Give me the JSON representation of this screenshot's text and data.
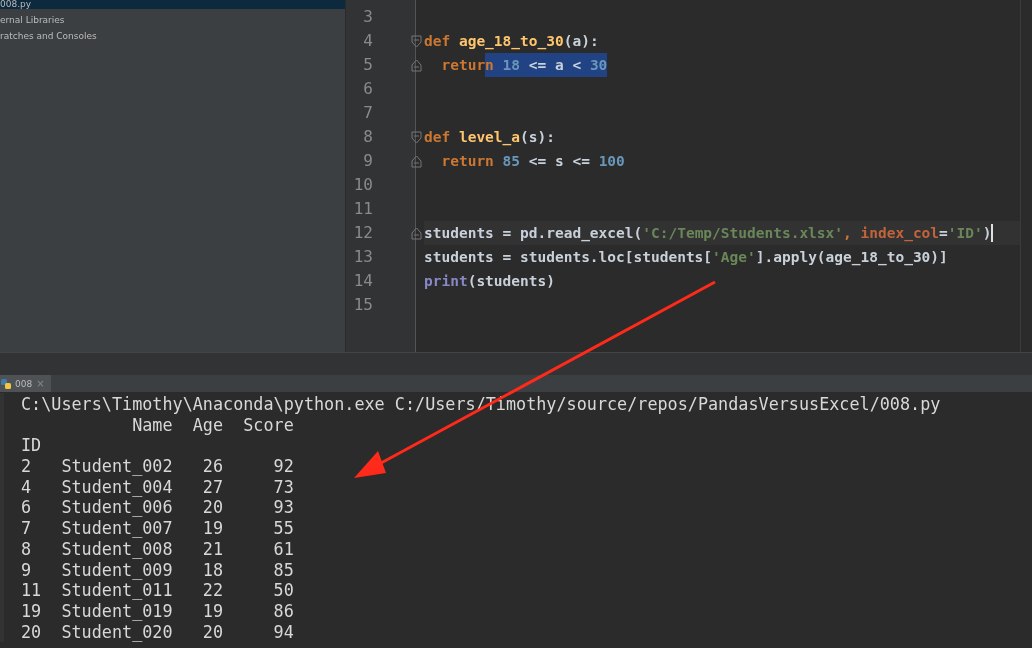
{
  "sidebar": {
    "items": [
      {
        "label": "008.py",
        "selected": true
      },
      {
        "label": "ernal Libraries",
        "selected": false
      },
      {
        "label": "ratches and Consoles",
        "selected": false
      }
    ]
  },
  "editor": {
    "lines": [
      {
        "number": "3",
        "kind": "plain",
        "current": false
      },
      {
        "number": "4",
        "kind": "fold_start",
        "current": false,
        "tokens": [
          {
            "text": "def ",
            "kind": "keyword"
          },
          {
            "text": "age_18_to_30",
            "kind": "function"
          },
          {
            "text": "(a):",
            "kind": "plain"
          }
        ]
      },
      {
        "number": "5",
        "kind": "fold_end",
        "current": false,
        "tokens": [
          {
            "text": "  retur",
            "kind": "keyword",
            "selected": false
          },
          {
            "text": "n",
            "kind": "keyword",
            "selected": true
          },
          {
            "text": " 18",
            "kind": "number",
            "selected": true
          },
          {
            "text": " <= a < ",
            "kind": "plain",
            "selected": true
          },
          {
            "text": "30",
            "kind": "number",
            "selected": true
          }
        ]
      },
      {
        "number": "6",
        "kind": "plain",
        "current": false
      },
      {
        "number": "7",
        "kind": "plain",
        "current": false
      },
      {
        "number": "8",
        "kind": "fold_start",
        "current": false,
        "tokens": [
          {
            "text": "def ",
            "kind": "keyword"
          },
          {
            "text": "level_a",
            "kind": "function"
          },
          {
            "text": "(s):",
            "kind": "plain"
          }
        ]
      },
      {
        "number": "9",
        "kind": "fold_end",
        "current": false,
        "tokens": [
          {
            "text": "  return ",
            "kind": "keyword"
          },
          {
            "text": "85",
            "kind": "number"
          },
          {
            "text": " <= s <= ",
            "kind": "plain"
          },
          {
            "text": "100",
            "kind": "number"
          }
        ]
      },
      {
        "number": "10",
        "kind": "plain",
        "current": false
      },
      {
        "number": "11",
        "kind": "plain",
        "current": false
      },
      {
        "number": "12",
        "kind": "fold_end",
        "current": true,
        "tokens": [
          {
            "text": "students = pd.read_excel(",
            "kind": "plain"
          },
          {
            "text": "'C:/Temp/Students.xlsx'",
            "kind": "string"
          },
          {
            "text": ", ",
            "kind": "keyword"
          },
          {
            "text": "index_col",
            "kind": "param"
          },
          {
            "text": "=",
            "kind": "plain"
          },
          {
            "text": "'ID'",
            "kind": "string"
          },
          {
            "text": ")",
            "kind": "plain"
          }
        ]
      },
      {
        "number": "13",
        "kind": "plain",
        "current": false,
        "tokens": [
          {
            "text": "students = students.loc[students[",
            "kind": "plain"
          },
          {
            "text": "'Age'",
            "kind": "string"
          },
          {
            "text": "].apply(age_18_to_30)]",
            "kind": "plain"
          }
        ]
      },
      {
        "number": "14",
        "kind": "plain",
        "current": false,
        "tokens": [
          {
            "text": "print",
            "kind": "builtin"
          },
          {
            "text": "(students)",
            "kind": "plain"
          }
        ]
      },
      {
        "number": "15",
        "kind": "plain",
        "current": false
      }
    ]
  },
  "run_tab": {
    "label": "008",
    "close": "×"
  },
  "console": {
    "lines": [
      "C:\\Users\\Timothy\\Anaconda\\python.exe C:/Users/Timothy/source/repos/PandasVersusExcel/008.py",
      "           Name  Age  Score",
      "ID",
      "2   Student_002   26     92",
      "4   Student_004   27     73",
      "6   Student_006   20     93",
      "7   Student_007   19     55",
      "8   Student_008   21     61",
      "9   Student_009   18     85",
      "11  Student_011   22     50",
      "19  Student_019   19     86",
      "20  Student_020   20     94"
    ]
  }
}
